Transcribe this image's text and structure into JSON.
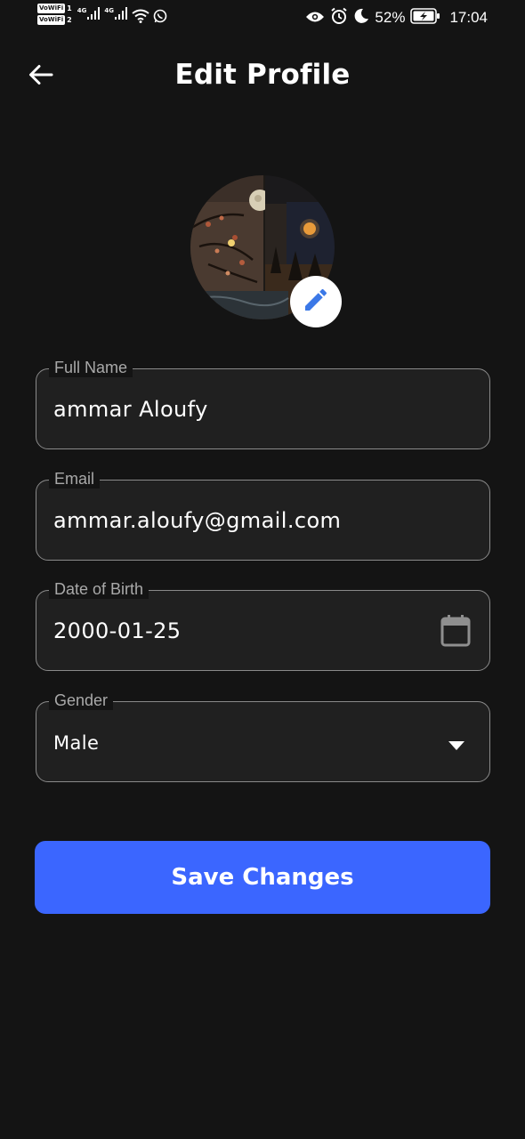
{
  "status_bar": {
    "vowifi_label": "VoWiFi",
    "sim1": "1",
    "sim2": "2",
    "network_tag": "4G",
    "battery_percent": "52%",
    "time": "17:04",
    "icons": [
      "signal-icon",
      "wifi-icon",
      "whatsapp-icon",
      "eye-icon",
      "alarm-icon",
      "moon-icon",
      "battery-charging-icon"
    ]
  },
  "header": {
    "title": "Edit Profile",
    "back_icon": "arrow-left-icon"
  },
  "avatar": {
    "edit_icon": "pencil-icon",
    "edit_icon_color": "#3b78e7"
  },
  "form": {
    "full_name": {
      "label": "Full Name",
      "value": "ammar Aloufy"
    },
    "email": {
      "label": "Email",
      "value": "ammar.aloufy@gmail.com"
    },
    "date_of_birth": {
      "label": "Date of Birth",
      "value": "2000-01-25",
      "icon": "calendar-icon"
    },
    "gender": {
      "label": "Gender",
      "value": "Male",
      "icon": "dropdown-arrow-icon"
    }
  },
  "actions": {
    "save_label": "Save Changes"
  },
  "colors": {
    "background": "#141414",
    "field_background": "#202020",
    "field_border": "#8a8a8a",
    "accent": "#3b66ff"
  }
}
